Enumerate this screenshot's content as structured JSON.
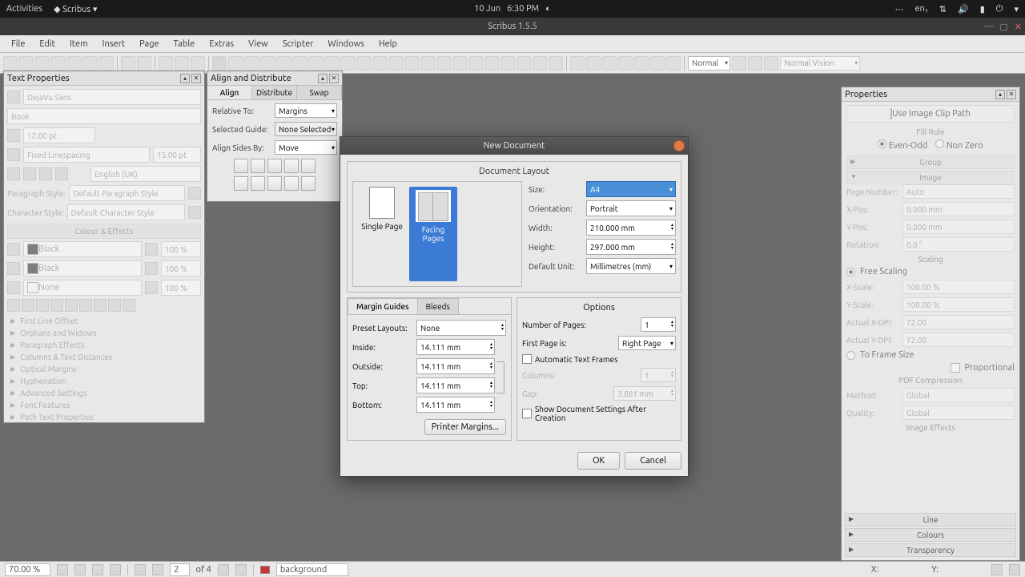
{
  "gnome": {
    "activities": "Activities",
    "app": "Scribus ▾",
    "date": "10 Jun",
    "time": "6:30 PM",
    "lang": "en₁"
  },
  "app": {
    "title": "Scribus 1.5.5"
  },
  "menu": [
    "File",
    "Edit",
    "Item",
    "Insert",
    "Page",
    "Table",
    "Extras",
    "View",
    "Scripter",
    "Windows",
    "Help"
  ],
  "toolbar": {
    "normal": "Normal",
    "vision": "Normal Vision"
  },
  "textProps": {
    "title": "Text Properties",
    "font": "DejaVu Sans",
    "style": "Book",
    "size": "12.00 pt",
    "lineMode": "Fixed Linespacing",
    "lineVal": "15.00 pt",
    "lang": "English (UK)",
    "paraLabel": "Paragraph Style:",
    "paraStyle": "Default Paragraph Style",
    "charLabel": "Character Style:",
    "charStyle": "Default Character Style",
    "colourHdr": "Colour & Effects",
    "fill": "Black",
    "fillPct": "100 %",
    "stroke": "Black",
    "strokePct": "100 %",
    "shade": "None",
    "shadePct": "100 %",
    "sections": [
      "First Line Offset",
      "Orphans and Widows",
      "Paragraph Effects",
      "Columns & Text Distances",
      "Optical Margins",
      "Hyphenation",
      "Advanced Settings",
      "Font Features",
      "Path Text Properties"
    ]
  },
  "align": {
    "title": "Align and Distribute",
    "tabs": [
      "Align",
      "Distribute",
      "Swap"
    ],
    "relLbl": "Relative To:",
    "relVal": "Margins",
    "guideLbl": "Selected Guide:",
    "guideVal": "None Selected",
    "sidesLbl": "Align Sides By:",
    "sidesVal": "Move"
  },
  "dialog": {
    "title": "New Document",
    "layoutHdr": "Document Layout",
    "single": "Single Page",
    "facing": "Facing Pages",
    "sizeLbl": "Size:",
    "sizeVal": "A4",
    "orientLbl": "Orientation:",
    "orientVal": "Portrait",
    "widthLbl": "Width:",
    "widthVal": "210.000 mm",
    "heightLbl": "Height:",
    "heightVal": "297.000 mm",
    "unitLbl": "Default Unit:",
    "unitVal": "Millimetres (mm)",
    "marginTab": "Margin Guides",
    "bleedTab": "Bleeds",
    "presetLbl": "Preset Layouts:",
    "presetVal": "None",
    "insideLbl": "Inside:",
    "outsideLbl": "Outside:",
    "topLbl": "Top:",
    "bottomLbl": "Bottom:",
    "marginVal": "14.111 mm",
    "printerBtn": "Printer Margins...",
    "optHdr": "Options",
    "numPagesLbl": "Number of Pages:",
    "numPagesVal": "1",
    "firstPageLbl": "First Page is:",
    "firstPageVal": "Right Page",
    "autoFrames": "Automatic Text Frames",
    "colsLbl": "Columns:",
    "colsVal": "1",
    "gapLbl": "Gap:",
    "gapVal": "3.881 mm",
    "showSettings": "Show Document Settings After Creation",
    "ok": "OK",
    "cancel": "Cancel"
  },
  "props": {
    "title": "Properties",
    "clipPath": "Use Image Clip Path",
    "fillRule": "Fill Rule",
    "evenOdd": "Even-Odd",
    "nonZero": "Non Zero",
    "group": "Group",
    "image": "Image",
    "pageNumLbl": "Page Number:",
    "pageNumVal": "Auto",
    "xposLbl": "X-Pos:",
    "yposLbl": "Y-Pos:",
    "posVal": "0.000 mm",
    "rotLbl": "Rotation:",
    "rotVal": "0.0 °",
    "scaling": "Scaling",
    "freeScaling": "Free Scaling",
    "xscaleLbl": "X-Scale:",
    "yscaleLbl": "Y-Scale:",
    "scaleVal": "100.00 %",
    "xdpiLbl": "Actual X-DPI:",
    "ydpiLbl": "Actual Y-DPI:",
    "dpiVal": "72.00",
    "toFrame": "To Frame Size",
    "prop": "Proportional",
    "pdfComp": "PDF Compression",
    "methodLbl": "Method:",
    "qualityLbl": "Quality:",
    "globalVal": "Global",
    "imgEffects": "Image Effects",
    "line": "Line",
    "colours": "Colours",
    "transparency": "Transparency"
  },
  "status": {
    "zoom": "70.00 %",
    "page": "2",
    "of": "of 4",
    "layer": "background",
    "xLbl": "X:",
    "yLbl": "Y:"
  }
}
